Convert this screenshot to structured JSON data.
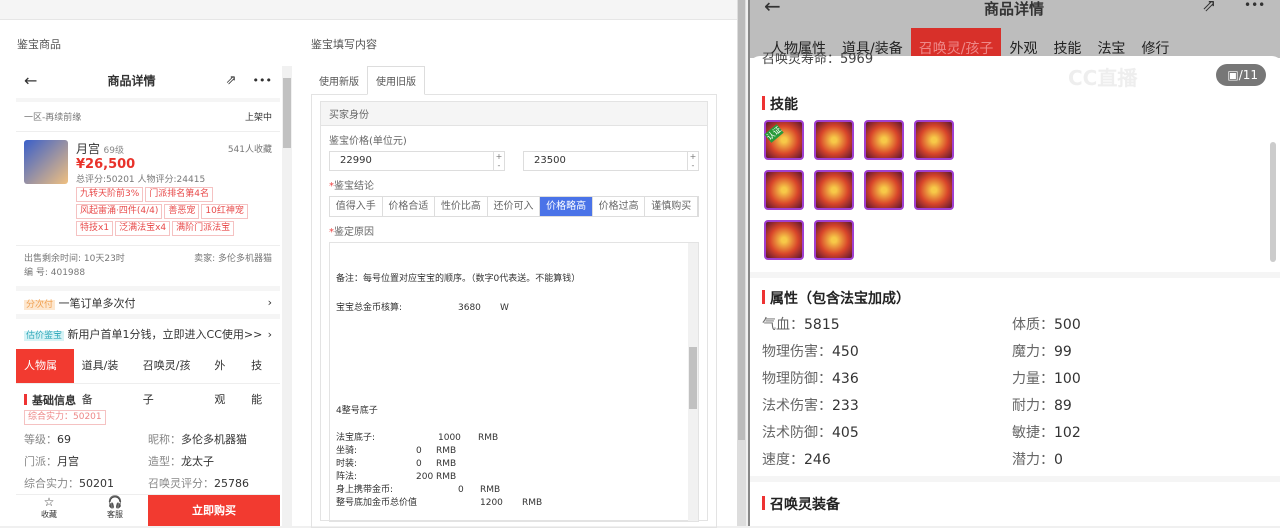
{
  "left_panel": {
    "goods_title": "鉴宝商品",
    "form_title": "鉴宝填写内容"
  },
  "phone": {
    "header_title": "商品详情",
    "server": "一区-再续前缘",
    "status": "上架中",
    "role_name": "月宫",
    "level": "69级",
    "favorites": "541人收藏",
    "price": "¥26,500",
    "scores": "总评分:50201   人物评分:24415",
    "tags": [
      "九转天阶前3%",
      "门派排名第4名",
      "风起雷涌·四件(4/4)",
      "善恶宠",
      "10红神宠",
      "特技x1",
      "泛满法宝x4",
      "满阶门派法宝"
    ],
    "remaining_time": "出售剩余时间: 10天23时",
    "seller": "卖家: 多伦多机器猫",
    "serial": "编 号: 401988",
    "promo1_badge": "分次付",
    "promo1_text": "一笔订单多次付",
    "promo2_badge": "估价鉴宝",
    "promo2_text": "新用户首单1分钱，立即进入CC使用>>",
    "tabs": [
      "人物属性",
      "道具/装备",
      "召唤灵/孩子",
      "外观",
      "技能"
    ],
    "basic_title": "基础信息",
    "power_badge": "综合实力：50201",
    "fields": [
      [
        "等级：",
        "69"
      ],
      [
        "昵称：",
        "多伦多机器猫"
      ],
      [
        "门派：",
        "月宫"
      ],
      [
        "造型：",
        "龙太子"
      ],
      [
        "综合实力：",
        "50201"
      ],
      [
        "召唤灵评分：",
        "25786"
      ]
    ],
    "bottom": {
      "fav": "收藏",
      "service": "客服",
      "buy": "立即购买"
    }
  },
  "form": {
    "tabs": [
      "使用新版",
      "使用旧版"
    ],
    "section": "买家身份",
    "price_label": "鉴宝价格(单位元)",
    "price_min": "22990",
    "price_max": "23500",
    "conclusion_label": "鉴宝结论",
    "conclusions": [
      "值得入手",
      "价格合适",
      "性价比高",
      "还价可入",
      "价格略高",
      "价格过高",
      "谨慎购买"
    ],
    "selected": "价格略高",
    "reason_label": "鉴定原因",
    "reason_lines": {
      "note": "备注：每号位置对应宝宝的顺序。（数字0代表送。不能算钱）",
      "pet_gold": [
        "宝宝总金币核算:",
        "3680",
        "W"
      ],
      "heading": "4整号底子",
      "rows": [
        [
          "法宝底子:",
          "1000",
          "RMB"
        ],
        [
          "坐骑:",
          "0",
          "RMB"
        ],
        [
          "时装:",
          "0",
          "RMB"
        ],
        [
          "阵法:",
          "200",
          "RMB"
        ],
        [
          "身上携带金币:",
          "0",
          "RMB"
        ],
        [
          "整号底加金币总价值",
          "1200",
          "RMB"
        ]
      ]
    }
  },
  "right": {
    "header_title": "商品详情",
    "tabs": [
      "人物属性",
      "道具/装备",
      "召唤灵/孩子",
      "外观",
      "技能",
      "法宝",
      "修行"
    ],
    "active_tab": "召唤灵/孩子",
    "lifespan": "召唤灵寿命：5969",
    "image_counter": "/11",
    "watermark": "CC直播",
    "skills_title": "技能",
    "skill_badge": "认证",
    "attr_title": "属性（包含法宝加成）",
    "attrs": [
      [
        "气血：",
        "5815"
      ],
      [
        "体质：",
        "500"
      ],
      [
        "物理伤害：",
        "450"
      ],
      [
        "魔力：",
        "99"
      ],
      [
        "物理防御：",
        "436"
      ],
      [
        "力量：",
        "100"
      ],
      [
        "法术伤害：",
        "233"
      ],
      [
        "耐力：",
        "89"
      ],
      [
        "法术防御：",
        "405"
      ],
      [
        "敏捷：",
        "102"
      ],
      [
        "速度：",
        "246"
      ],
      [
        "潜力：",
        "0"
      ]
    ],
    "equip_title": "召唤灵装备"
  },
  "colors": {
    "accent_red": "#f23a30",
    "selected_blue": "#4a73e8",
    "skill_border": "#a040d0"
  }
}
